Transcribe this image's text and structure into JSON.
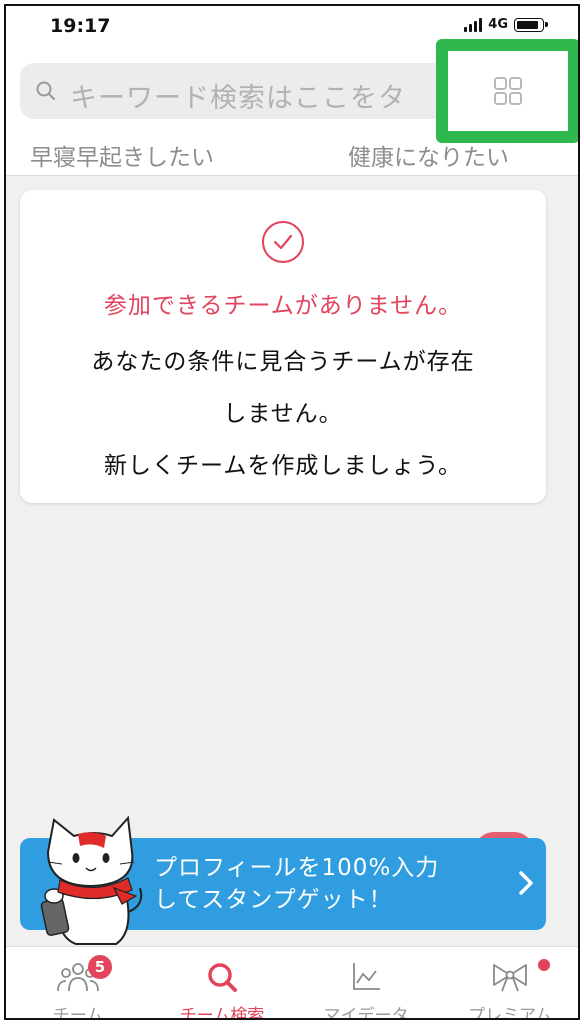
{
  "status_bar": {
    "time": "19:17",
    "network": "4G"
  },
  "search": {
    "placeholder": "キーワード検索はここをタ"
  },
  "tags": [
    "早寝早起きしたい",
    "健康になりたい"
  ],
  "card": {
    "title": "参加できるチームがありません。",
    "lines": [
      "あなたの条件に見合うチームが存在",
      "しません。",
      "新しくチームを作成しましょう。"
    ]
  },
  "banner": {
    "text": "プロフィールを100%入力\nしてスタンプゲット！"
  },
  "nav": {
    "items": [
      {
        "label": "チーム",
        "badge": "5"
      },
      {
        "label": "チーム検索"
      },
      {
        "label": "マイデータ"
      },
      {
        "label": "プレミアム"
      }
    ]
  },
  "colors": {
    "accent": "#e2445c",
    "highlight": "#2fb84e",
    "banner": "#2f9ddf"
  },
  "icons": [
    "search-icon",
    "grid-icon",
    "check-circle-icon",
    "chevron-right-icon",
    "team-icon",
    "team-search-icon",
    "chart-icon",
    "bow-icon"
  ]
}
